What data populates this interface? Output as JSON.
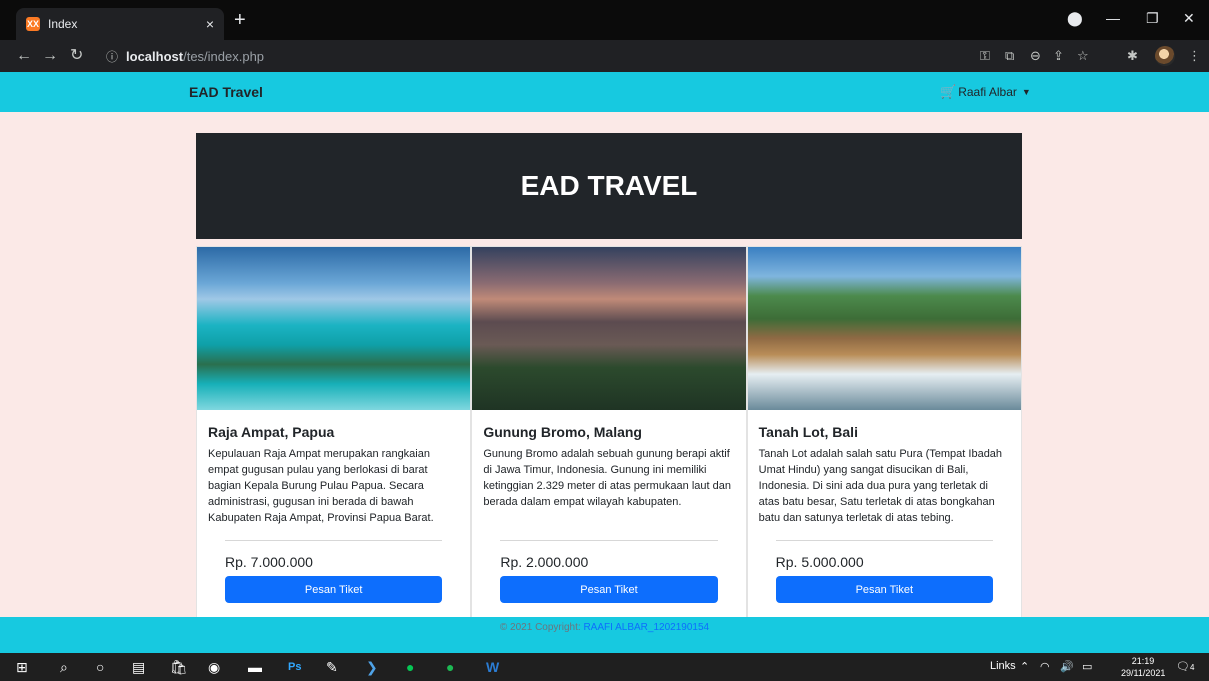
{
  "browser": {
    "tab_title": "Index",
    "tab_close": "×",
    "new_tab": "+",
    "favicon": "XX",
    "url_host": "localhost",
    "url_path": "/tes/index.php",
    "window_controls": [
      "—",
      "❐",
      "✕"
    ]
  },
  "navbar": {
    "brand": "EAD Travel",
    "user": "Raafi Albar",
    "cart_icon": "cart-icon",
    "caret_icon": "caret-down-icon"
  },
  "hero": {
    "title": "EAD TRAVEL"
  },
  "cards": [
    {
      "title": "Raja Ampat, Papua",
      "text": "Kepulauan Raja Ampat merupakan rangkaian empat gugusan pulau yang berlokasi di barat bagian Kepala Burung Pulau Papua. Secara administrasi, gugusan ini berada di bawah Kabupaten Raja Ampat, Provinsi Papua Barat.",
      "price": "Rp. 7.000.000",
      "button": "Pesan Tiket"
    },
    {
      "title": "Gunung Bromo, Malang",
      "text": "Gunung Bromo adalah sebuah gunung berapi aktif di Jawa Timur, Indonesia. Gunung ini memiliki ketinggian 2.329 meter di atas permukaan laut dan berada dalam empat wilayah kabupaten.",
      "price": "Rp. 2.000.000",
      "button": "Pesan Tiket"
    },
    {
      "title": "Tanah Lot, Bali",
      "text": "Tanah Lot adalah salah satu Pura (Tempat Ibadah Umat Hindu) yang sangat disucikan di Bali, Indonesia. Di sini ada dua pura yang terletak di atas batu besar, Satu terletak di atas bongkahan batu dan satunya terletak di atas tebing.",
      "price": "Rp. 5.000.000",
      "button": "Pesan Tiket"
    }
  ],
  "footer": {
    "copyright": "© 2021 Copyright:",
    "author": "RAAFI ALBAR_1202190154"
  },
  "taskbar": {
    "links_label": "Links",
    "time": "21:19",
    "date": "29/11/2021",
    "notifications": "4"
  }
}
